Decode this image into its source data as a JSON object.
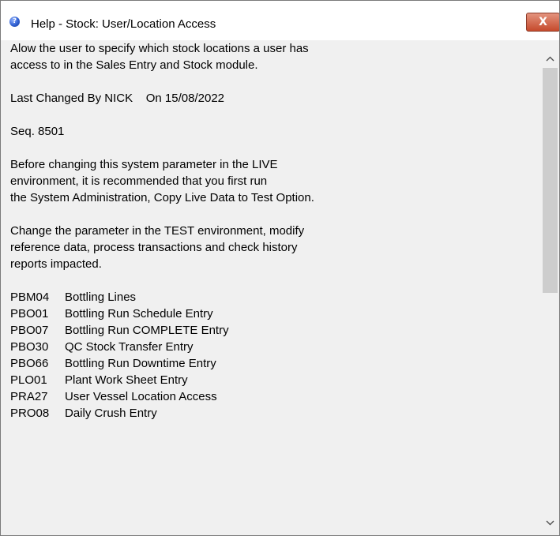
{
  "window": {
    "title": "Help - Stock: User/Location Access",
    "close_glyph": "X"
  },
  "content": {
    "intro_line1": "Alow the user to specify which stock locations a user has",
    "intro_line2": "access to in the Sales Entry and Stock module.",
    "last_changed": "Last Changed By NICK    On 15/08/2022",
    "seq": "Seq. 8501",
    "warn_line1": "Before changing this system parameter in the LIVE",
    "warn_line2": "environment, it is recommended that you first run",
    "warn_line3": "the System Administration, Copy Live Data to Test Option.",
    "change_line1": "Change the parameter in the TEST environment, modify",
    "change_line2": "reference data, process transactions and check history",
    "change_line3": "reports impacted.",
    "programs": [
      {
        "code": "PBM04",
        "name": "Bottling Lines"
      },
      {
        "code": "PBO01",
        "name": "Bottling Run Schedule Entry"
      },
      {
        "code": "PBO07",
        "name": "Bottling Run COMPLETE Entry"
      },
      {
        "code": "PBO30",
        "name": "QC Stock Transfer Entry"
      },
      {
        "code": "PBO66",
        "name": "Bottling Run Downtime Entry"
      },
      {
        "code": "PLO01",
        "name": "Plant Work Sheet Entry"
      },
      {
        "code": "PRA27",
        "name": "User Vessel Location Access"
      },
      {
        "code": "PRO08",
        "name": "Daily Crush Entry"
      }
    ]
  },
  "icons": {
    "window_icon": "help-icon",
    "close": "close-icon",
    "scroll_up": "chevron-up-icon",
    "scroll_down": "chevron-down-icon"
  }
}
